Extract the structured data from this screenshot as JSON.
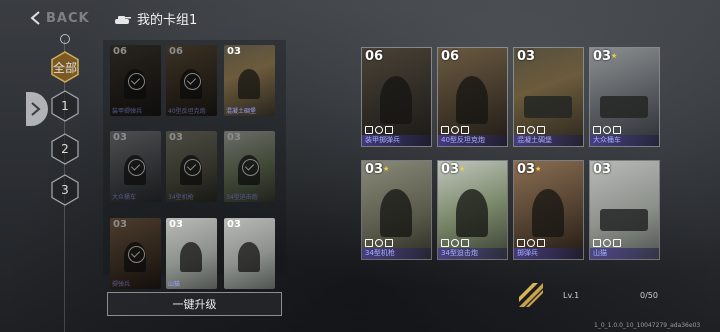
{
  "header": {
    "back_label": "BACK",
    "title": "我的卡组1"
  },
  "nav": {
    "items": [
      {
        "label": "全部",
        "active": true
      },
      {
        "label": "1"
      },
      {
        "label": "2"
      },
      {
        "label": "3"
      }
    ]
  },
  "deck_cards": [
    {
      "cost": "06",
      "name": "装甲掷弹兵",
      "selected": true,
      "art": "a1"
    },
    {
      "cost": "06",
      "name": "40型反坦克炮",
      "selected": true,
      "art": "a2"
    },
    {
      "cost": "03",
      "name": "混凝土碉堡",
      "selected": false,
      "art": "a3"
    },
    {
      "cost": "03",
      "name": "大众桶车",
      "selected": true,
      "art": "a4"
    },
    {
      "cost": "03",
      "name": "34型机枪",
      "selected": true,
      "art": "a5"
    },
    {
      "cost": "03",
      "name": "34型迫击炮",
      "selected": true,
      "art": "a6"
    },
    {
      "cost": "03",
      "name": "掷弹兵",
      "selected": true,
      "art": "a7"
    },
    {
      "cost": "03",
      "name": "山猫",
      "selected": false,
      "art": "a8"
    },
    {
      "cost": "03",
      "name": "",
      "selected": false,
      "art": "a8"
    }
  ],
  "upgrade_button": "一键升级",
  "cards": [
    {
      "cost": "06",
      "name": "装甲掷弹兵",
      "art": "a1",
      "star": false
    },
    {
      "cost": "06",
      "name": "40型反坦克炮",
      "art": "a2",
      "star": false
    },
    {
      "cost": "03",
      "name": "混凝土碉堡",
      "art": "a3",
      "star": false
    },
    {
      "cost": "03",
      "name": "大众桶车",
      "art": "a4",
      "star": true
    },
    {
      "cost": "03",
      "name": "34型机枪",
      "art": "a5",
      "star": true
    },
    {
      "cost": "03",
      "name": "34型迫击炮",
      "art": "a6",
      "star": true
    },
    {
      "cost": "03",
      "name": "掷弹兵",
      "art": "a7",
      "star": true
    },
    {
      "cost": "03",
      "name": "山猫",
      "art": "a8",
      "star": false
    }
  ],
  "level": {
    "label": "Lv.1",
    "progress_text": "0/50",
    "progress": 0
  },
  "build_version": "1_0_1.0.0_10_10047279_ada36e03",
  "colors": {
    "card_name": "#a8b0ff",
    "accent_gold": "#c9a44a",
    "star": "#f0d040"
  }
}
